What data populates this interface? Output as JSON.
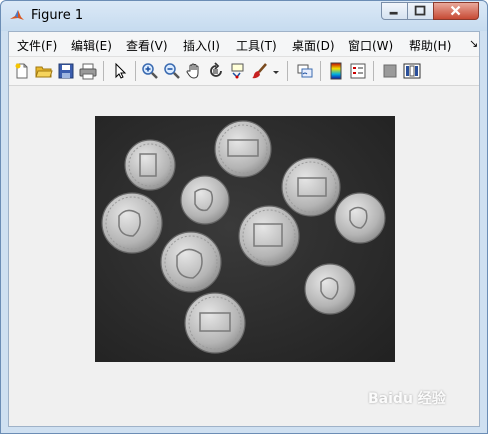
{
  "window": {
    "title": "Figure 1",
    "title_ghost": "",
    "controls": [
      "minimize-button",
      "maximize-button",
      "close-button"
    ]
  },
  "menu": {
    "items": [
      "文件(F)",
      "编辑(E)",
      "查看(V)",
      "插入(I)",
      "工具(T)",
      "桌面(D)",
      "窗口(W)",
      "帮助(H)"
    ],
    "overflow": "↘"
  },
  "toolbar": {
    "icons": [
      "new-figure-icon",
      "open-file-icon",
      "save-icon",
      "print-icon",
      "select-arrow-icon",
      "zoom-in-icon",
      "zoom-out-icon",
      "pan-hand-icon",
      "rotate-3d-icon",
      "data-cursor-icon",
      "brush-icon",
      "brush-dropdown-icon",
      "link-plot-icon",
      "colorbar-icon",
      "legend-icon",
      "hide-plot-tools-icon",
      "show-plot-tools-icon"
    ]
  },
  "figure": {
    "image_content": "coins",
    "background_color": "#2d2d2d",
    "coin_color": "#c8c8c8"
  },
  "watermark": {
    "text": "Baidu 经验"
  }
}
